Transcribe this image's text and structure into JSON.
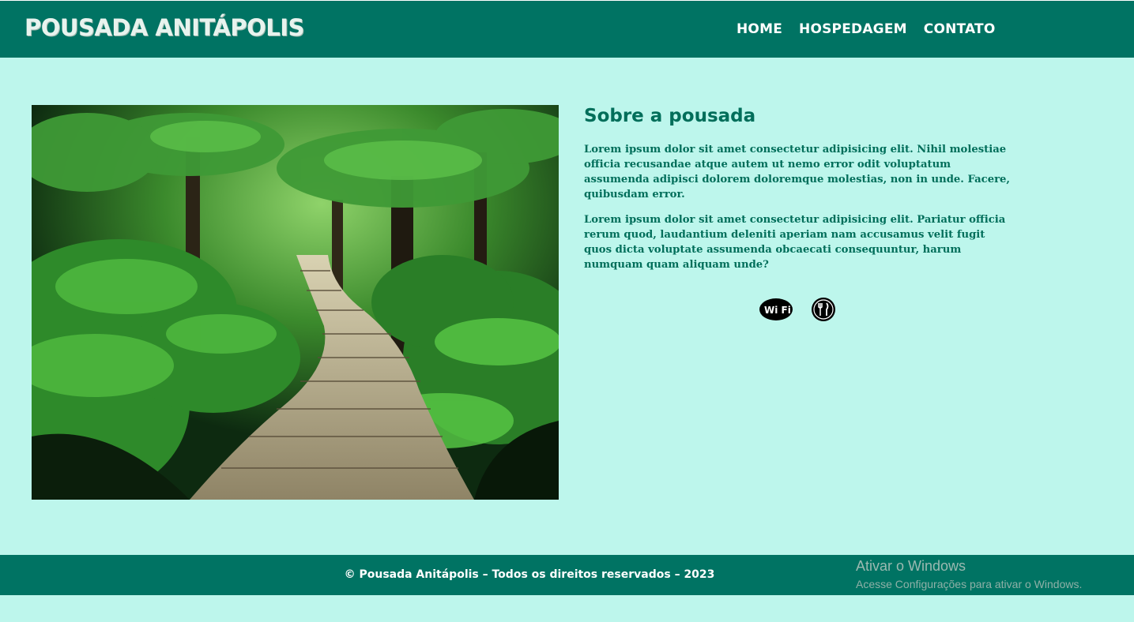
{
  "header": {
    "logo": "POUSADA ANITÁPOLIS",
    "nav": [
      "HOME",
      "HOSPEDAGEM",
      "CONTATO"
    ]
  },
  "main": {
    "image_alt": "forest boardwalk",
    "title": "Sobre a pousada",
    "paragraphs": [
      "Lorem ipsum dolor sit amet consectetur adipisicing elit. Nihil molestiae officia recusandae atque autem ut nemo error odit voluptatum assumenda adipisci dolorem doloremque molestias, non in unde. Facere, quibusdam error.",
      "Lorem ipsum dolor sit amet consectetur adipisicing elit. Pariatur officia rerum quod, laudantium deleniti aperiam nam accusamus velit fugit quos dicta voluptate assumenda obcaecati consequuntur, harum numquam quam aliquam unde?"
    ],
    "icons": [
      "wifi-icon",
      "restaurant-icon"
    ],
    "wifi_text": "Wi Fi"
  },
  "footer": {
    "text": "© Pousada Anitápolis – Todos os direitos reservados – 2023"
  },
  "watermark": {
    "title": "Ativar o Windows",
    "subtitle": "Acesse Configurações para ativar o Windows."
  },
  "colors": {
    "primary": "#007363",
    "background": "#bdf6ec",
    "text": "#006e5a"
  }
}
